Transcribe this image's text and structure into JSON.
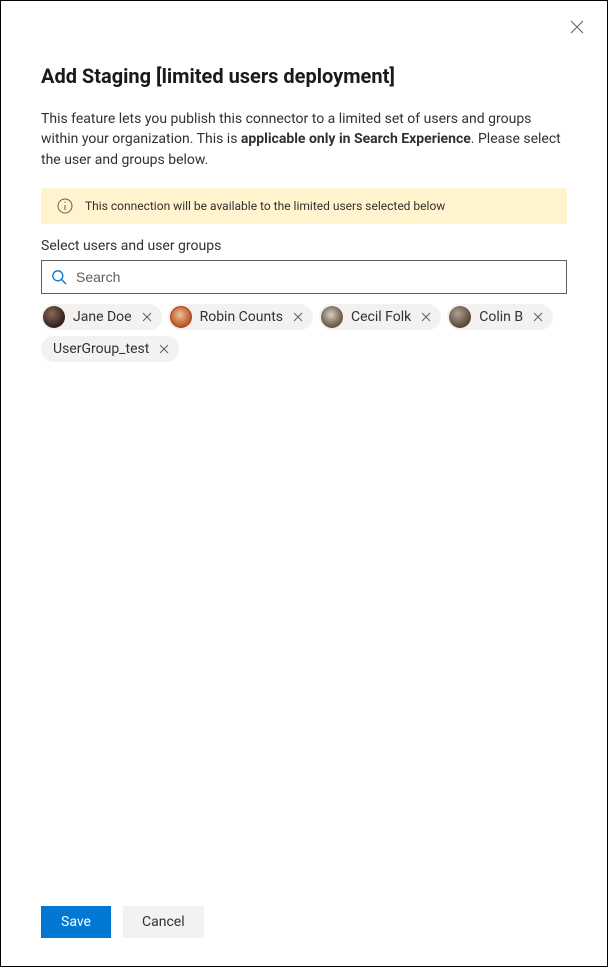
{
  "header": {
    "title": "Add Staging [limited users deployment]"
  },
  "description": {
    "prefix": "This feature lets you publish this connector to a limited set of users and groups within your organization. This is ",
    "bold": "applicable only in Search Experience",
    "suffix": ". Please select the user and groups below."
  },
  "banner": {
    "text": "This connection will be available to the limited users selected below"
  },
  "selector": {
    "label": "Select users and user groups",
    "placeholder": "Search"
  },
  "chips": [
    {
      "label": "Jane Doe",
      "has_avatar": true,
      "avatar_class": "a1"
    },
    {
      "label": "Robin Counts",
      "has_avatar": true,
      "avatar_class": "a2"
    },
    {
      "label": "Cecil Folk",
      "has_avatar": true,
      "avatar_class": "a3"
    },
    {
      "label": "Colin B",
      "has_avatar": true,
      "avatar_class": "a4"
    },
    {
      "label": "UserGroup_test",
      "has_avatar": false,
      "avatar_class": ""
    }
  ],
  "footer": {
    "save": "Save",
    "cancel": "Cancel"
  }
}
